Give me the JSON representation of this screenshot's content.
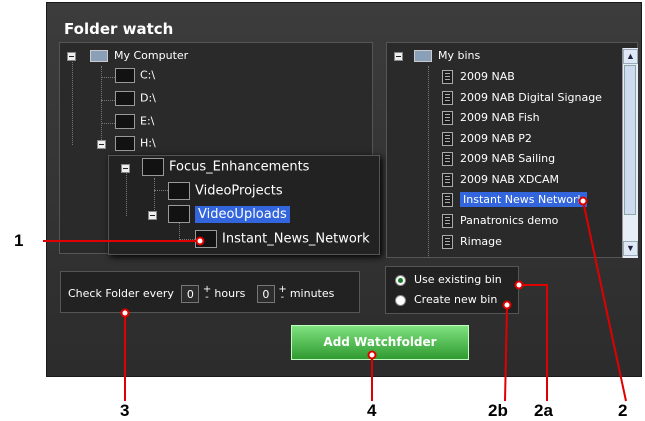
{
  "panel": {
    "title": "Folder watch"
  },
  "computer_tree": {
    "root": "My Computer",
    "drives": [
      "C:\\",
      "D:\\",
      "E:\\",
      "H:\\"
    ]
  },
  "popup_tree": {
    "items": [
      "Focus_Enhancements",
      "VideoProjects",
      "VideoUploads",
      "Instant_News_Network"
    ]
  },
  "bins_tree": {
    "root": "My bins",
    "items": [
      "2009 NAB",
      "2009 NAB Digital Signage",
      "2009 NAB Fish",
      "2009 NAB P2",
      "2009 NAB Sailing",
      "2009 NAB XDCAM",
      "Instant News Network",
      "Panatronics demo",
      "Rimage"
    ],
    "selected": "Instant News Network"
  },
  "check": {
    "label": "Check Folder every",
    "hours_value": "0",
    "hours_label": "hours",
    "minutes_value": "0",
    "minutes_label": "minutes",
    "plus": "+",
    "minus": "-"
  },
  "bin_options": {
    "use_existing": "Use existing bin",
    "create_new": "Create new bin",
    "selected": "use_existing"
  },
  "add_button": {
    "label": "Add Watchfolder"
  },
  "callouts": {
    "c1": "1",
    "c2": "2",
    "c2a": "2a",
    "c2b": "2b",
    "c3": "3",
    "c4": "4"
  },
  "colors": {
    "panel": "#333333",
    "selection": "#3366dd",
    "button": "#2f9a2f",
    "callout_line": "#e00000"
  }
}
